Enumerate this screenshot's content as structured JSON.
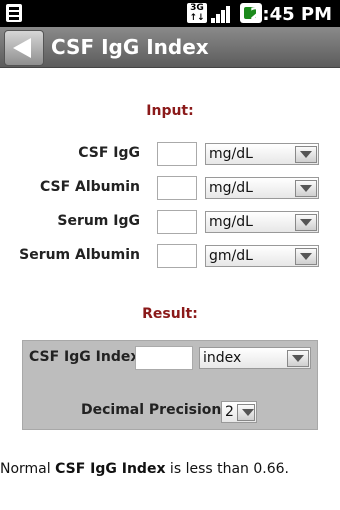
{
  "status_bar": {
    "network": "3G",
    "time": "2:45 PM"
  },
  "header": {
    "title": "CSF IgG Index"
  },
  "input": {
    "title": "Input:",
    "fields": [
      {
        "label": "CSF IgG",
        "value": "",
        "unit": "mg/dL"
      },
      {
        "label": "CSF Albumin",
        "value": "",
        "unit": "mg/dL"
      },
      {
        "label": "Serum IgG",
        "value": "",
        "unit": "mg/dL"
      },
      {
        "label": "Serum Albumin",
        "value": "",
        "unit": "gm/dL"
      }
    ]
  },
  "result": {
    "title": "Result:",
    "label": "CSF IgG Index",
    "value": "",
    "unit": "index",
    "precision_label": "Decimal Precision:",
    "precision_value": "2"
  },
  "footer": {
    "prefix": "Normal ",
    "bold": "CSF IgG Index",
    "suffix": " is less than 0.66."
  }
}
